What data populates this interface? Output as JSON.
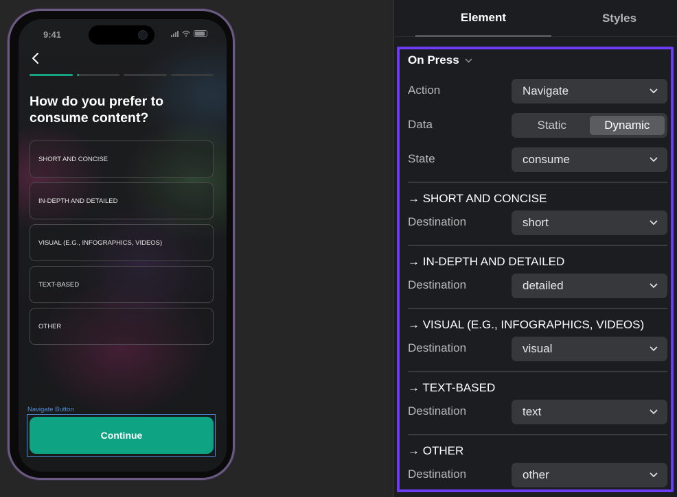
{
  "phone": {
    "status_time": "9:41",
    "question": "How do you prefer to consume content?",
    "progress": [
      1.0,
      0.05,
      0,
      0
    ],
    "options": [
      "SHORT AND CONCISE",
      "IN-DEPTH AND DETAILED",
      "VISUAL (E.G., INFOGRAPHICS, VIDEOS)",
      "TEXT-BASED",
      "OTHER"
    ],
    "nav_button_label": "Navigate Button",
    "continue_label": "Continue",
    "accent_color": "#0ea382"
  },
  "panel": {
    "tabs": {
      "element": "Element",
      "styles": "Styles"
    },
    "on_press": "On Press",
    "action_label": "Action",
    "action_value": "Navigate",
    "data_label": "Data",
    "data_options": {
      "static": "Static",
      "dynamic": "Dynamic"
    },
    "data_selected": "Dynamic",
    "state_label": "State",
    "state_value": "consume",
    "destination_label": "Destination",
    "cases": [
      {
        "title": "→ SHORT AND CONCISE",
        "destination": "short"
      },
      {
        "title": "→ IN-DEPTH AND DETAILED",
        "destination": "detailed"
      },
      {
        "title": "→ VISUAL (E.G., INFOGRAPHICS, VIDEOS)",
        "destination": "visual"
      },
      {
        "title": "→ TEXT-BASED",
        "destination": "text"
      },
      {
        "title": "→ OTHER",
        "destination": "other"
      }
    ],
    "highlight_color": "#6b3cf5"
  }
}
